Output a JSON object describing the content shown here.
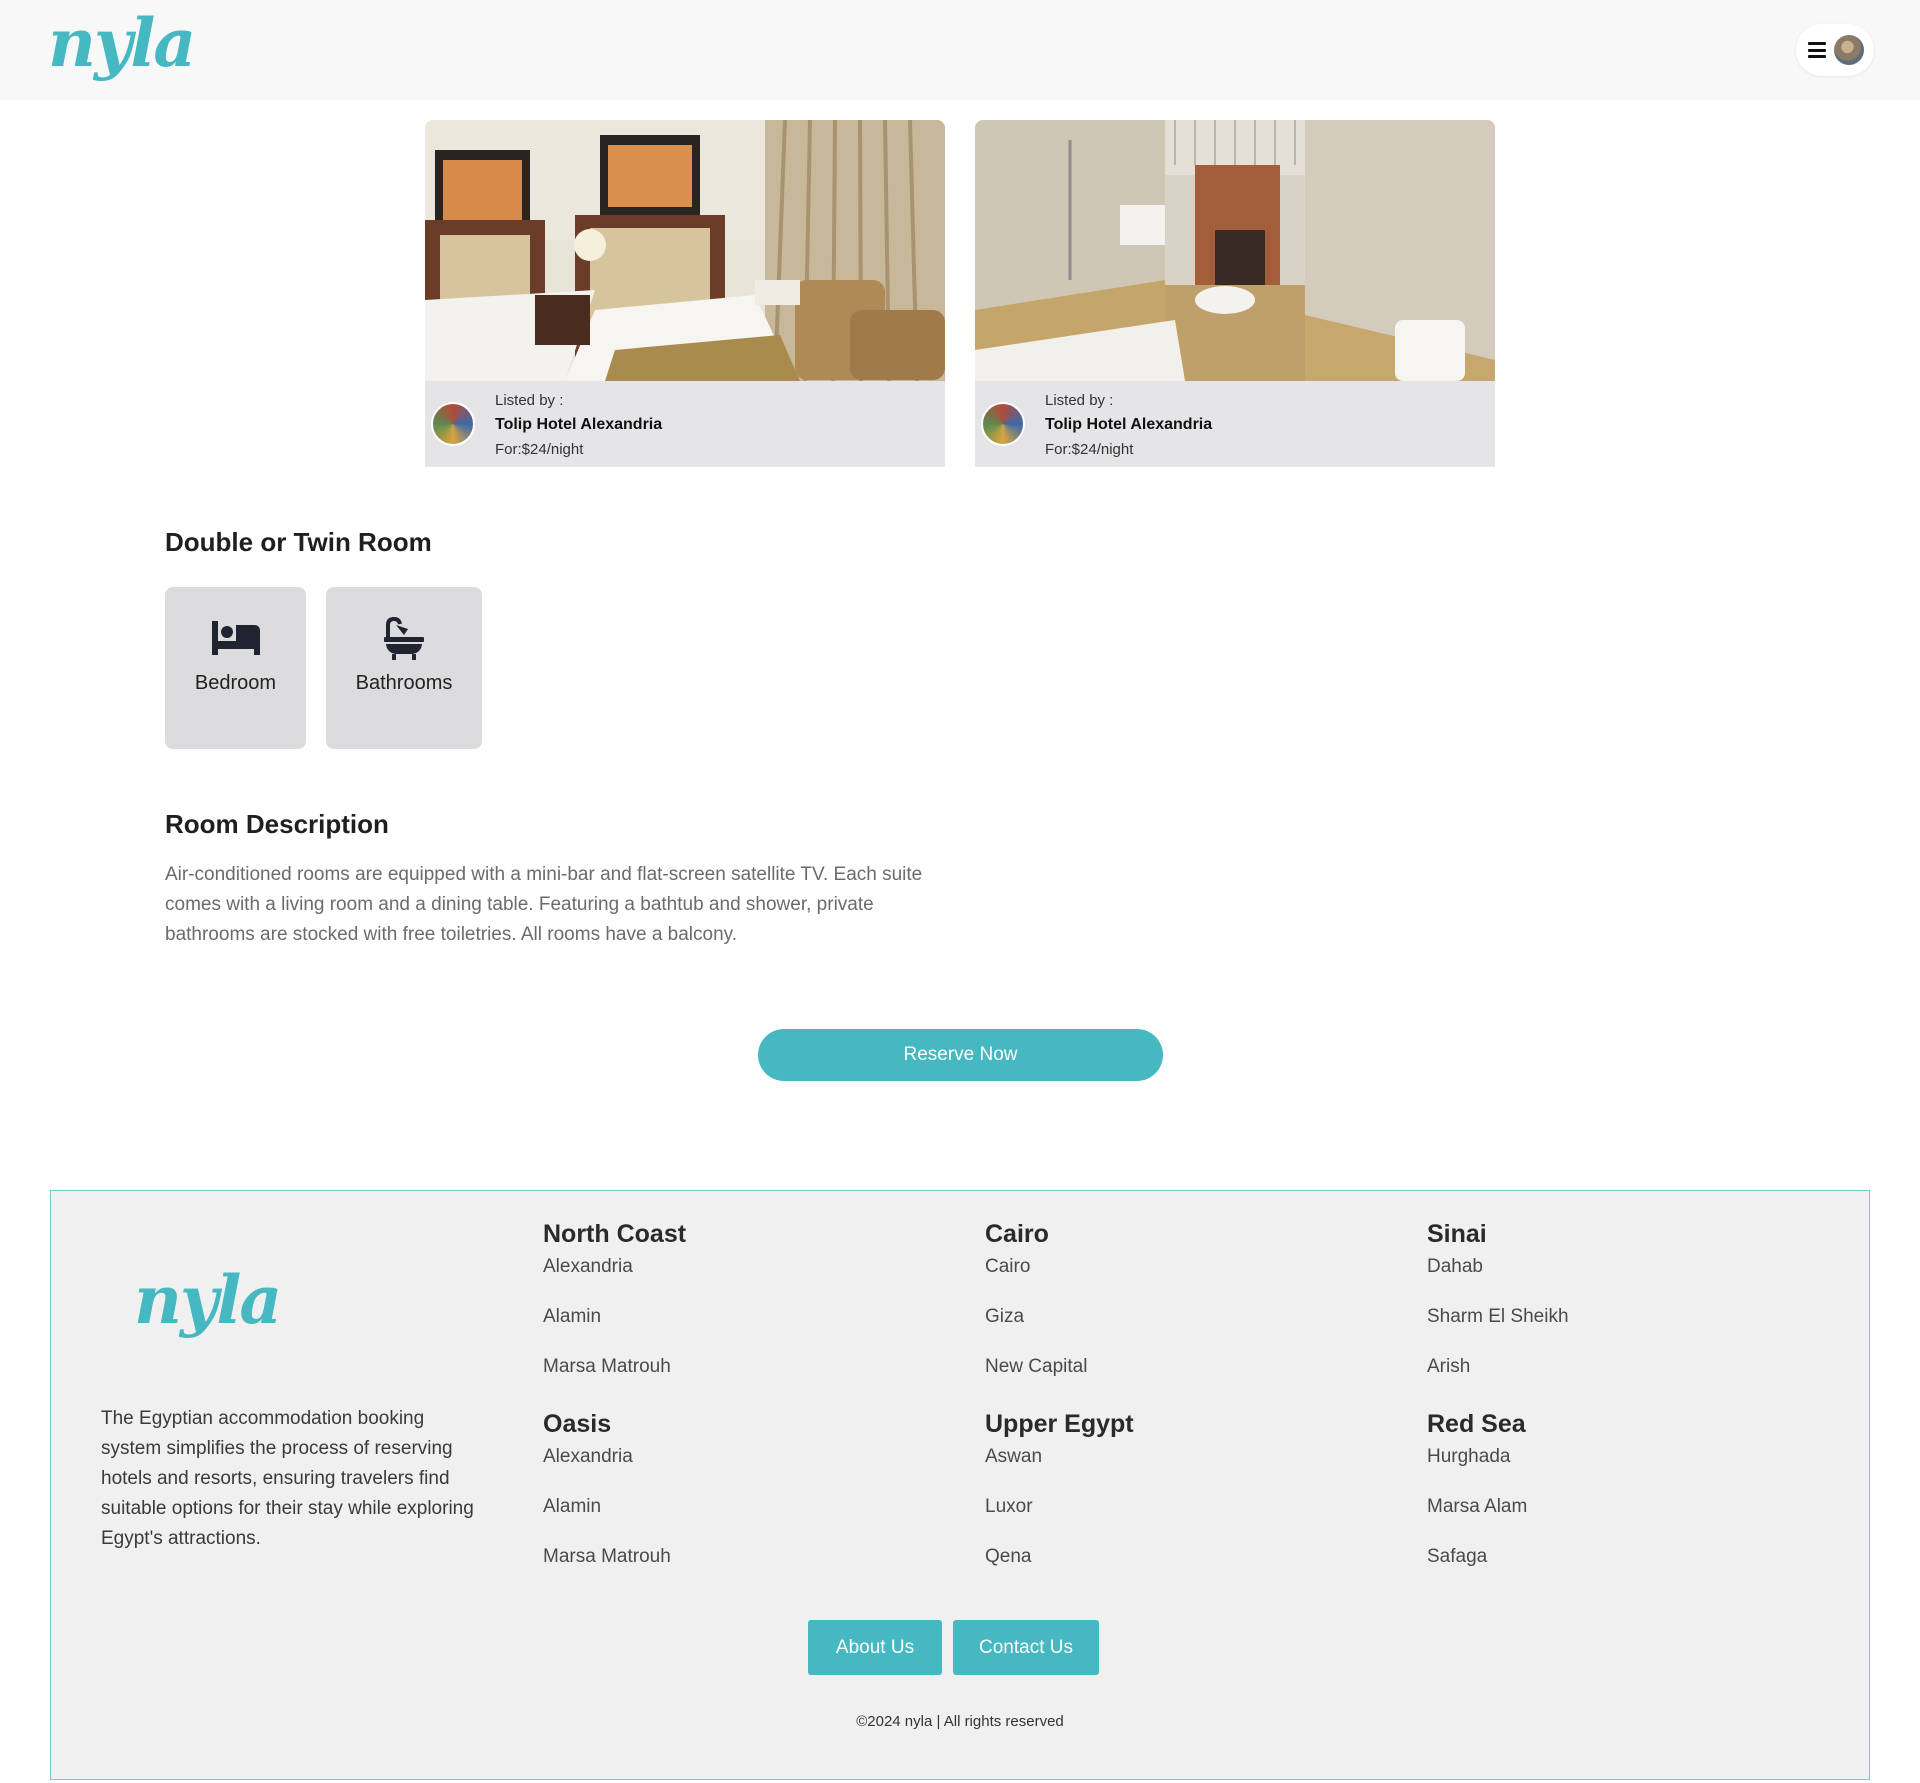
{
  "header": {
    "logo_text": "nyla",
    "menu_icon": "hamburger-icon",
    "avatar_icon": "user-avatar"
  },
  "listings": [
    {
      "image": "hotel-twin-bedroom-photo",
      "listed_by_label": "Listed by :",
      "hotel_name": "Tolip Hotel Alexandria",
      "price": "For:$24/night"
    },
    {
      "image": "hotel-bathroom-photo",
      "listed_by_label": "Listed by :",
      "hotel_name": "Tolip Hotel Alexandria",
      "price": "For:$24/night"
    }
  ],
  "room": {
    "title": "Double or Twin Room",
    "features": [
      {
        "icon": "bed-icon",
        "label": "Bedroom"
      },
      {
        "icon": "bathtub-icon",
        "label": "Bathrooms"
      }
    ],
    "description_title": "Room Description",
    "description": "Air-conditioned rooms are equipped with a mini-bar and flat-screen satellite TV. Each suite comes with a living room and a dining table. Featuring a bathtub and shower, private bathrooms are stocked with free toiletries. All rooms have a balcony."
  },
  "reserve_button": "Reserve Now",
  "footer": {
    "logo_text": "nyla",
    "about_text": "The Egyptian accommodation booking system simplifies the process of reserving hotels and resorts, ensuring travelers find suitable options for their stay while exploring Egypt's attractions.",
    "regions": [
      {
        "title": "North Coast",
        "items": [
          "Alexandria",
          "Alamin",
          "Marsa Matrouh"
        ]
      },
      {
        "title": "Cairo",
        "items": [
          "Cairo",
          "Giza",
          "New Capital"
        ]
      },
      {
        "title": "Sinai",
        "items": [
          "Dahab",
          "Sharm El Sheikh",
          "Arish"
        ]
      },
      {
        "title": "Oasis",
        "items": [
          "Alexandria",
          "Alamin",
          "Marsa Matrouh"
        ]
      },
      {
        "title": "Upper Egypt",
        "items": [
          "Aswan",
          "Luxor",
          "Qena"
        ]
      },
      {
        "title": "Red Sea",
        "items": [
          "Hurghada",
          "Marsa Alam",
          "Safaga"
        ]
      }
    ],
    "about_button": "About Us",
    "contact_button": "Contact Us",
    "copyright": "©2024 nyla | All rights reserved"
  },
  "colors": {
    "brand": "#45b8c1",
    "card_bg": "#e5e5e8",
    "footer_bg": "#f0f0f0"
  }
}
